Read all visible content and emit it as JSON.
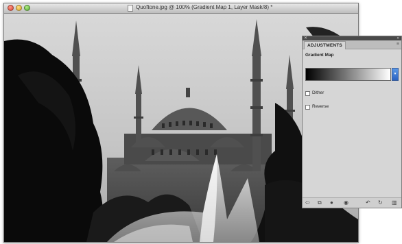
{
  "document": {
    "title": "Quoftone.jpg @ 100% (Gradient Map 1, Layer Mask/8) *",
    "icons": {
      "close": "close-icon",
      "minimize": "minimize-icon",
      "zoom": "zoom-icon",
      "doc": "document-icon"
    }
  },
  "photo": {
    "description_icon": "mosque-photo",
    "sky_color": "#c9c9c9",
    "dark_color": "#0a0a0a"
  },
  "panel": {
    "tab_label": "ADJUSTMENTS",
    "adjustment_title": "Gradient Map",
    "dither_label": "Dither",
    "reverse_label": "Reverse",
    "dither_checked": false,
    "reverse_checked": false,
    "gradient_from": "#000000",
    "gradient_to": "#ffffff",
    "icons": {
      "close": "close-icon",
      "collapse": "double-arrow-icon",
      "menu": "panel-menu-icon",
      "dropdown": "chevron-down-icon",
      "bottom": [
        "return-arrow-icon",
        "clip-layer-icon",
        "visibility-icon",
        "eye-icon",
        "previous-state-icon",
        "reset-icon",
        "trash-icon"
      ]
    }
  }
}
